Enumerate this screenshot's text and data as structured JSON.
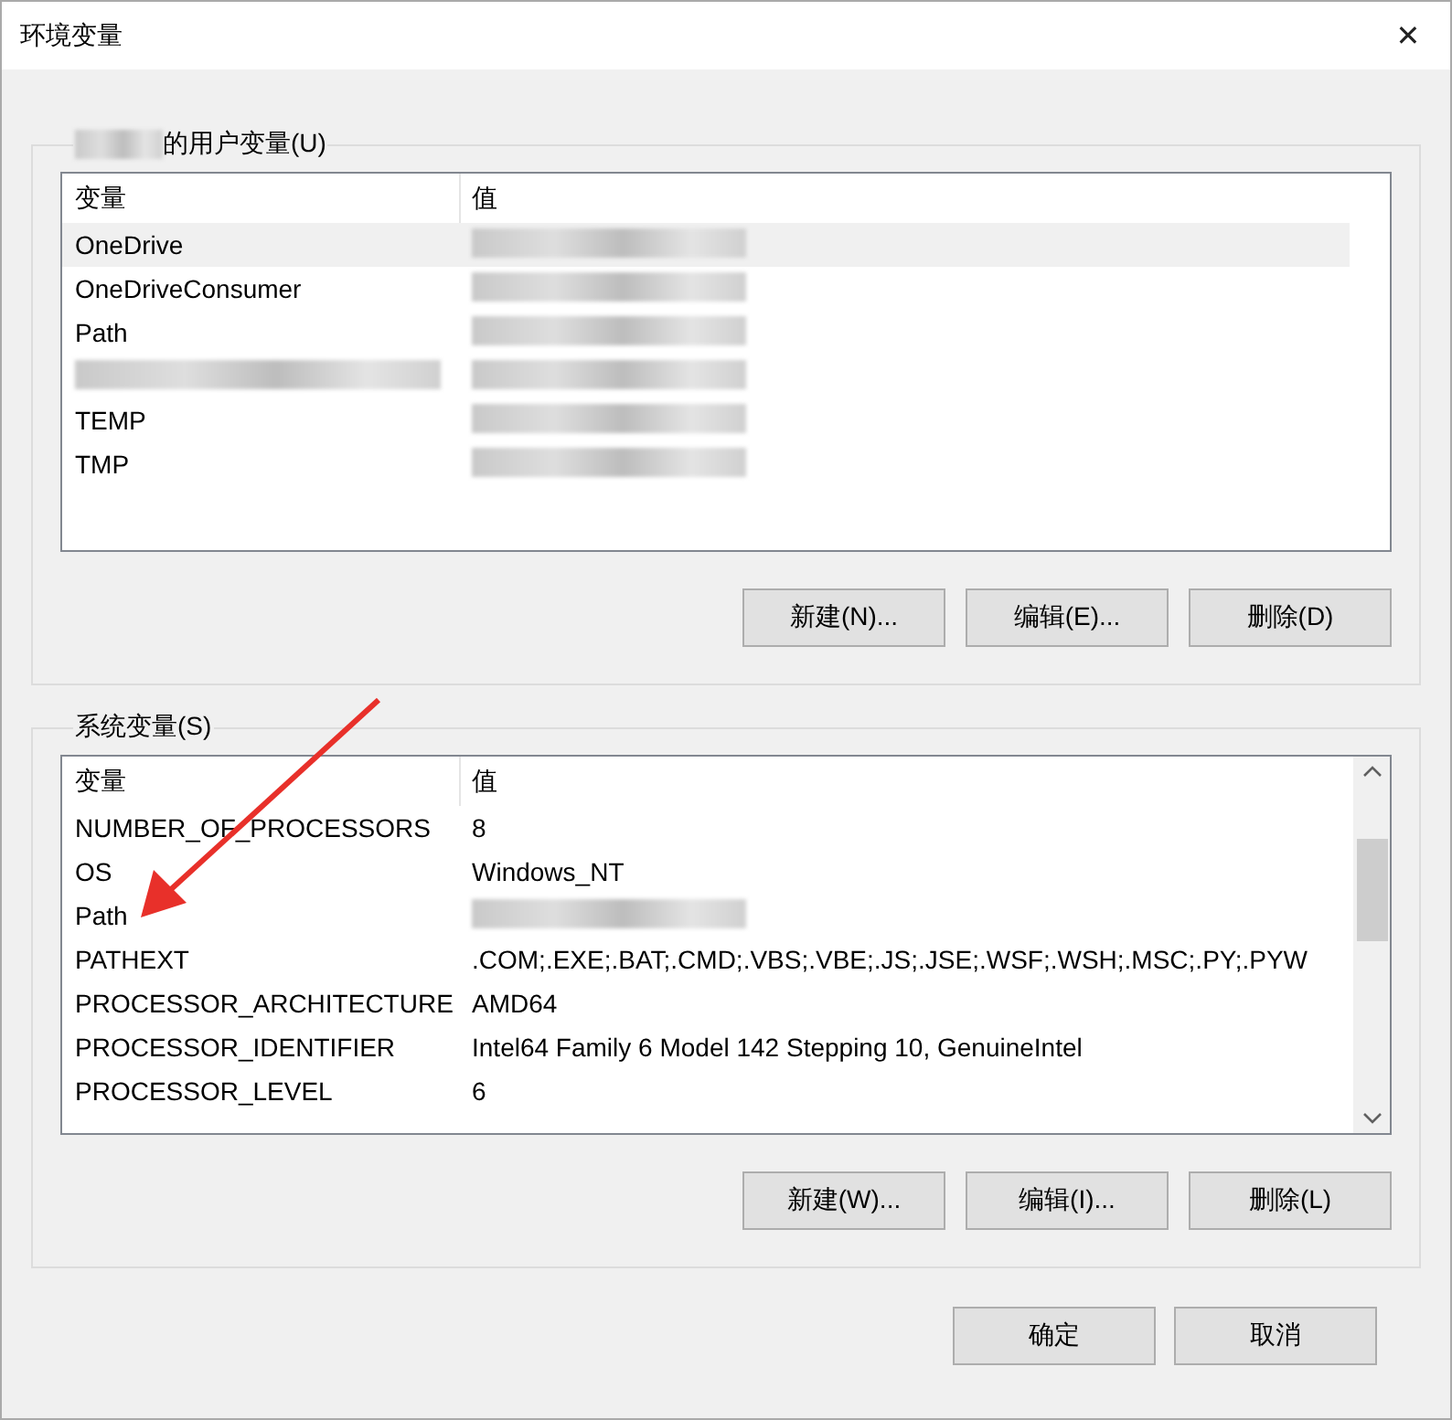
{
  "window": {
    "title": "环境变量",
    "close": "✕"
  },
  "user_variables": {
    "title": "的用户变量(U)",
    "title_redacted_prefix": true,
    "columns": [
      "变量",
      "值"
    ],
    "rows": [
      {
        "name": "OneDrive",
        "value_redacted": true,
        "selected": true
      },
      {
        "name": "OneDriveConsumer",
        "value_redacted": true,
        "selected": false
      },
      {
        "name": "Path",
        "value_redacted": true,
        "selected": false
      },
      {
        "name_redacted": true,
        "value_redacted": true,
        "selected": false
      },
      {
        "name": "TEMP",
        "value_redacted": true,
        "selected": false
      },
      {
        "name": "TMP",
        "value_redacted": true,
        "selected": false
      }
    ],
    "buttons": [
      "新建(N)...",
      "编辑(E)...",
      "删除(D)"
    ]
  },
  "system_variables": {
    "title": "系统变量(S)",
    "columns": [
      "变量",
      "值"
    ],
    "rows": [
      {
        "name": "NUMBER_OF_PROCESSORS",
        "value": "8",
        "selected": false
      },
      {
        "name": "OS",
        "value": "Windows_NT",
        "selected": false
      },
      {
        "name": "Path",
        "value_redacted": true,
        "selected": false
      },
      {
        "name": "PATHEXT",
        "value": ".COM;.EXE;.BAT;.CMD;.VBS;.VBE;.JS;.JSE;.WSF;.WSH;.MSC;.PY;.PYW",
        "selected": false
      },
      {
        "name": "PROCESSOR_ARCHITECTURE",
        "value": "AMD64",
        "selected": false
      },
      {
        "name": "PROCESSOR_IDENTIFIER",
        "value": "Intel64 Family 6 Model 142 Stepping 10, GenuineIntel",
        "selected": false
      },
      {
        "name": "PROCESSOR_LEVEL",
        "value": "6",
        "selected": false
      }
    ],
    "scrollbar": true,
    "buttons": [
      "新建(W)...",
      "编辑(I)...",
      "删除(L)"
    ]
  },
  "dialog_buttons": [
    "确定",
    "取消"
  ]
}
